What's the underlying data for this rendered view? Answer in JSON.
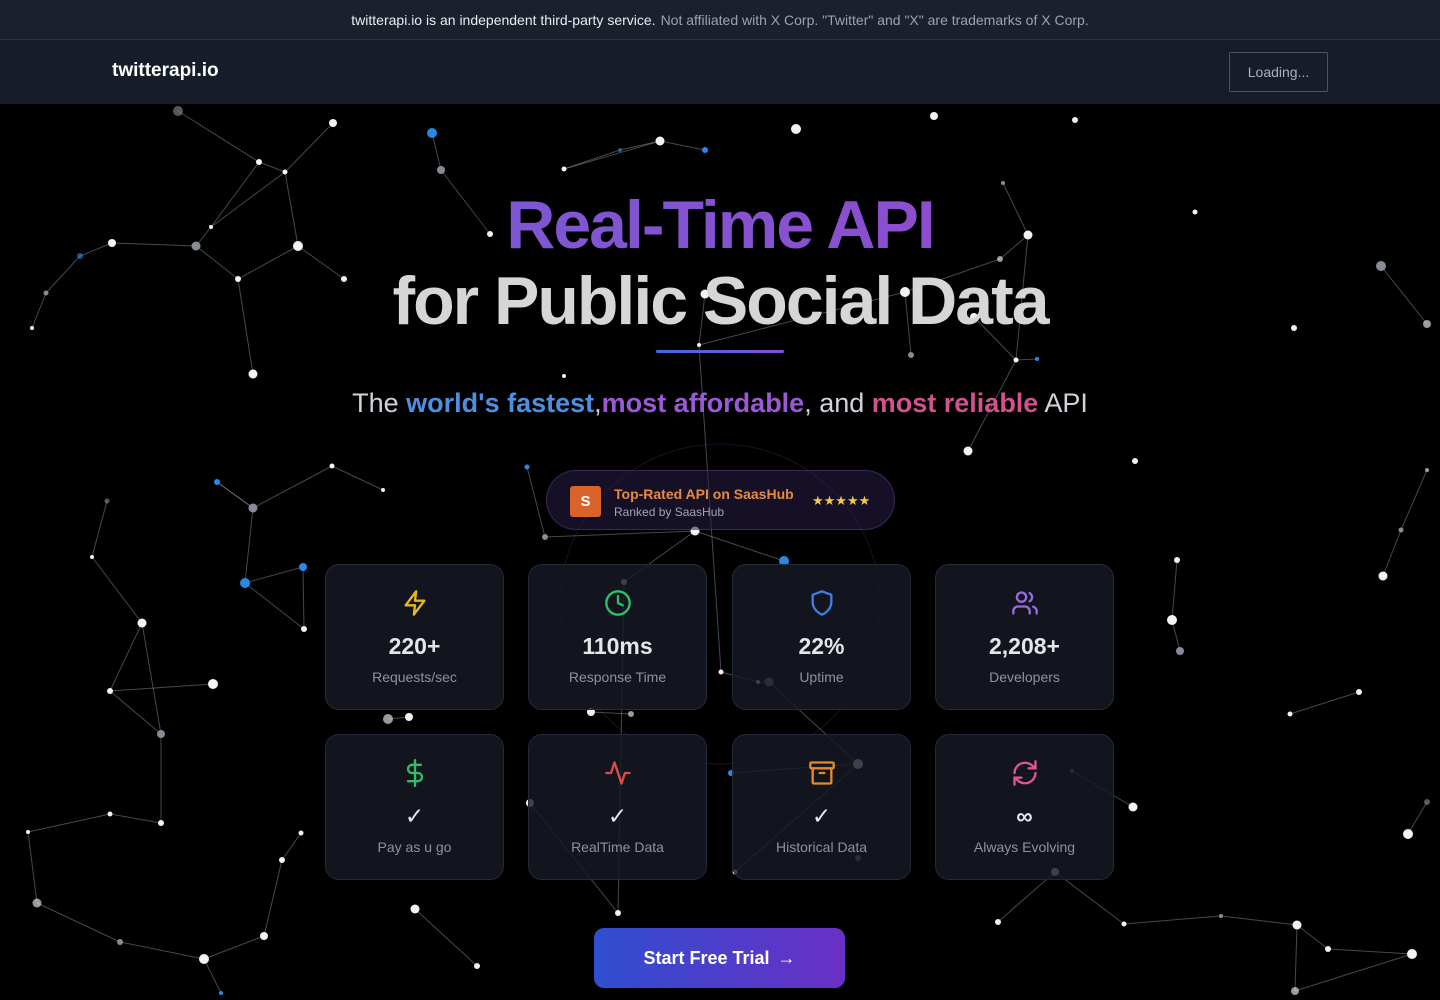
{
  "banner": {
    "strong": "twitterapi.io is an independent third-party service.",
    "muted": "Not affiliated with X Corp. \"Twitter\" and \"X\" are trademarks of X Corp."
  },
  "nav": {
    "brand": "twitterapi.io",
    "loading_label": "Loading..."
  },
  "hero": {
    "title_line1": "Real-Time API",
    "title_line2": "for Public Social Data",
    "tagline": {
      "prefix": "The ",
      "part1": "world's fastest",
      "sep1": ",",
      "part2": "most affordable",
      "sep2": ", and ",
      "part3": "most reliable",
      "suffix": " API"
    }
  },
  "badge": {
    "logo_letter": "S",
    "title": "Top-Rated API on SaasHub",
    "subtitle": "Ranked by SaasHub",
    "stars": "★★★★★"
  },
  "stats": [
    {
      "icon": "lightning-icon",
      "value": "220+",
      "label": "Requests/sec",
      "color": "#e8b820"
    },
    {
      "icon": "clock-icon",
      "value": "110ms",
      "label": "Response Time",
      "color": "#2fbf6a"
    },
    {
      "icon": "shield-icon",
      "value": "22%",
      "label": "Uptime",
      "color": "#3f7ee0"
    },
    {
      "icon": "users-icon",
      "value": "2,208+",
      "label": "Developers",
      "color": "#9a6ae0"
    },
    {
      "icon": "dollar-icon",
      "value": "✓",
      "label": "Pay as u go",
      "color": "#2fbf6a"
    },
    {
      "icon": "activity-icon",
      "value": "✓",
      "label": "RealTime Data",
      "color": "#e04a4a"
    },
    {
      "icon": "archive-icon",
      "value": "✓",
      "label": "Historical Data",
      "color": "#e58a2a"
    },
    {
      "icon": "refresh-icon",
      "value": "∞",
      "label": "Always Evolving",
      "color": "#e0558e"
    }
  ],
  "cta": {
    "label": "Start Free Trial",
    "arrow": "→"
  },
  "colors": {
    "accent_blue": "#3f6fd8",
    "accent_purple": "#8a4fd0",
    "accent_pink": "#d2528e",
    "background": "#000000"
  }
}
